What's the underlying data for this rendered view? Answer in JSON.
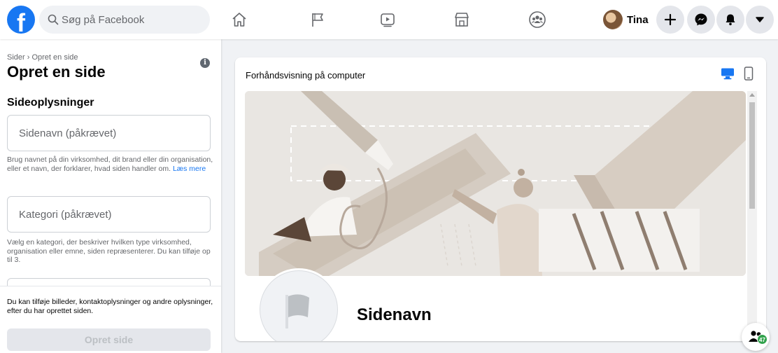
{
  "topbar": {
    "logo_letter": "f",
    "search_placeholder": "Søg på Facebook",
    "nav_icons": [
      "home-icon",
      "flag-icon",
      "watch-icon",
      "marketplace-icon",
      "groups-icon"
    ],
    "user_name": "Tina",
    "action_icons": [
      "plus-icon",
      "messenger-icon",
      "bell-icon",
      "caret-down-icon"
    ]
  },
  "left": {
    "breadcrumb": "Sider › Opret en side",
    "title": "Opret en side",
    "info_glyph": "i",
    "section_title": "Sideoplysninger",
    "name_placeholder": "Sidenavn (påkrævet)",
    "name_help": "Brug navnet på din virksomhed, dit brand eller din organisation, eller et navn, der forklarer, hvad siden handler om.",
    "name_help_link": "Læs mere",
    "category_placeholder": "Kategori (påkrævet)",
    "category_help": "Vælg en kategori, der beskriver hvilken type virksomhed, organisation eller emne, siden repræsenterer. Du kan tilføje op til 3.",
    "bottom_note": "Du kan tilføje billeder, kontaktoplysninger og andre oplysninger, efter du har oprettet siden.",
    "create_button": "Opret side"
  },
  "preview": {
    "title": "Forhåndsvisning på computer",
    "device_icons": [
      "desktop-icon",
      "mobile-icon"
    ],
    "page_name": "Sidenavn"
  },
  "contacts_badge": "47",
  "colors": {
    "brand": "#1877f2",
    "background": "#f0f2f5",
    "online": "#31a24c"
  }
}
